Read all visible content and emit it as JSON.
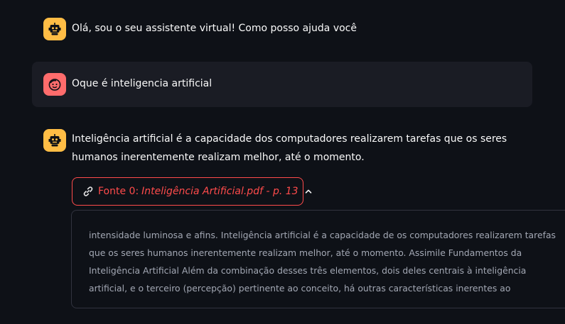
{
  "colors": {
    "background": "#0e1117",
    "user_bubble": "#1a1c24",
    "bot_avatar": "#ffbd45",
    "user_avatar": "#ff6c6c",
    "accent": "#ff4b4b",
    "muted_text": "#a3a8b4"
  },
  "messages": [
    {
      "role": "assistant",
      "avatar_icon": "robot-icon",
      "text": "Olá, sou o seu assistente virtual! Como posso ajuda você"
    },
    {
      "role": "user",
      "avatar_icon": "smiley-face-icon",
      "text": "Oque é inteligencia artificial"
    },
    {
      "role": "assistant",
      "avatar_icon": "robot-icon",
      "text": "Inteligência artificial é a capacidade dos computadores realizarem tarefas que os seres humanos inerentemente realizam melhor, até o momento."
    }
  ],
  "source": {
    "icon": "link-icon",
    "prefix": "Fonte 0:",
    "document": "Inteligência Artificial.pdf - p. 13",
    "expanded_icon": "chevron-up-icon",
    "content": "intensidade luminosa e afins. Inteligência artificial é a capacidade de os computadores realizarem tarefas que os seres humanos inerentemente realizam melhor, até o momento. Assimile Fundamentos da Inteligência Artificial Além da combinação desses três elementos, dois deles centrais à inteligência artificial, e o terceiro (percepção) pertinente ao conceito, há outras características inerentes ao"
  }
}
